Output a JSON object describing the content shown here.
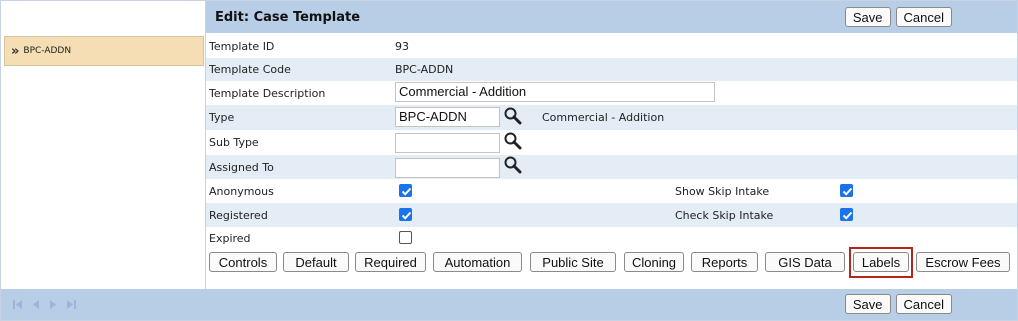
{
  "nav": {
    "item_label": "BPC-ADDN",
    "pager_icons": [
      "first-page-icon",
      "prev-page-icon",
      "next-page-icon",
      "last-page-icon"
    ]
  },
  "header": {
    "title": "Edit: Case Template",
    "save_label": "Save",
    "cancel_label": "Cancel"
  },
  "form": {
    "template_id_label": "Template ID",
    "template_id_value": "93",
    "template_code_label": "Template Code",
    "template_code_value": "BPC-ADDN",
    "template_description_label": "Template Description",
    "template_description_value": "Commercial - Addition",
    "type_label": "Type",
    "type_value": "BPC-ADDN",
    "type_description": "Commercial - Addition",
    "subtype_label": "Sub Type",
    "subtype_value": "",
    "assigned_to_label": "Assigned To",
    "assigned_to_value": "",
    "anonymous_label": "Anonymous",
    "anonymous_checked": true,
    "show_skip_intake_label": "Show Skip Intake",
    "show_skip_intake_checked": true,
    "registered_label": "Registered",
    "registered_checked": true,
    "check_skip_intake_label": "Check Skip Intake",
    "check_skip_intake_checked": true,
    "expired_label": "Expired",
    "expired_checked": false
  },
  "tabs": {
    "controls": "Controls",
    "default": "Default",
    "required": "Required",
    "automation": "Automation",
    "public_site": "Public Site",
    "cloning": "Cloning",
    "reports": "Reports",
    "gis_data": "GIS Data",
    "labels": "Labels",
    "escrow_fees": "Escrow Fees"
  },
  "footer": {
    "save_label": "Save",
    "cancel_label": "Cancel"
  },
  "colors": {
    "header_bg": "#b8cde6",
    "alt_row_bg": "#e4ecf5",
    "nav_selected_bg": "#f5deb3",
    "checkbox_on": "#1a73e8",
    "highlight_border": "#b3261e"
  }
}
